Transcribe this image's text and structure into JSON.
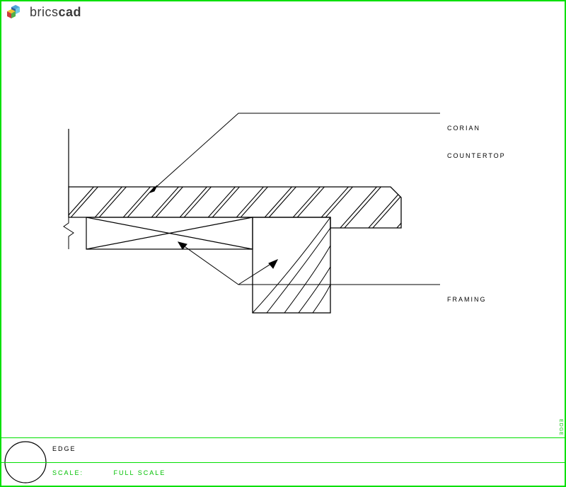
{
  "app": {
    "brand_prefix": "brics",
    "brand_suffix": "cad"
  },
  "labels": {
    "corian_line1": "CORIAN",
    "corian_line2": "COUNTERTOP",
    "framing": "FRAMING"
  },
  "titleblock": {
    "name": "EDGE",
    "scale_label": "SCALE:",
    "scale_value": "FULL SCALE"
  },
  "side": "EDGE",
  "colors": {
    "frame": "#00e000",
    "ink": "#000000"
  }
}
